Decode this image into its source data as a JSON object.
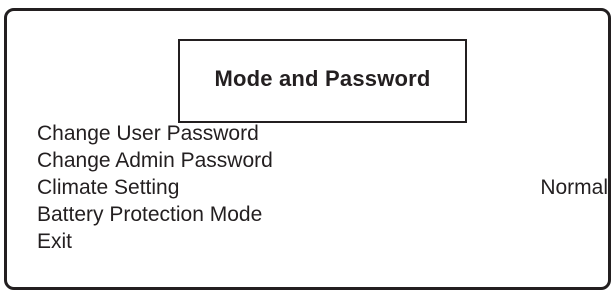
{
  "dialog": {
    "title": "Mode and Password"
  },
  "menu": {
    "items": [
      {
        "label": "Change User Password",
        "value": ""
      },
      {
        "label": "Change Admin Password",
        "value": ""
      },
      {
        "label": "Climate Setting",
        "value": "Normal"
      },
      {
        "label": "Battery Protection Mode",
        "value": ""
      },
      {
        "label": "Exit",
        "value": ""
      }
    ]
  },
  "colors": {
    "foreground": "#231f20",
    "background": "#ffffff"
  }
}
